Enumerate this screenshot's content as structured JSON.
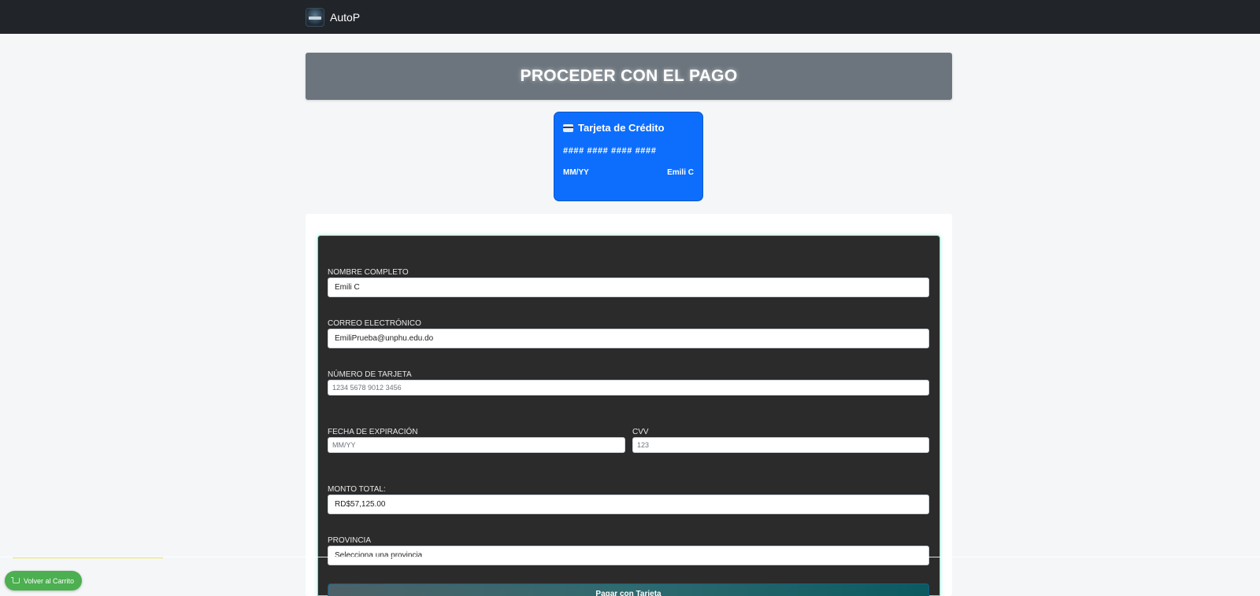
{
  "navbar": {
    "brand_name": "AutoP",
    "logo_icon": "autop-logo"
  },
  "page": {
    "title": "PROCEDER CON EL PAGO"
  },
  "card_preview": {
    "icon": "credit-card-icon",
    "title": "Tarjeta de Crédito",
    "number": "#### #### #### ####",
    "expiry": "MM/YY",
    "holder": "Emili C",
    "color": "#0d6efd"
  },
  "form": {
    "name": {
      "label": "NOMBRE COMPLETO",
      "value": "Emili C"
    },
    "email": {
      "label": "CORREO ELECTRÓNICO",
      "value": "EmiliPrueba@unphu.edu.do"
    },
    "card_number": {
      "label": "NÚMERO DE TARJETA",
      "placeholder": "1234 5678 9012 3456"
    },
    "expiry": {
      "label": "FECHA DE EXPIRACIÓN",
      "placeholder": "MM/YY"
    },
    "cvv": {
      "label": "CVV",
      "placeholder": "123"
    },
    "total": {
      "label": "MONTO TOTAL:",
      "value": "RD$57,125.00"
    },
    "province": {
      "label": "PROVINCIA",
      "selected": "Selecciona una provincia"
    },
    "pay_button": "Pagar con Tarjeta"
  },
  "floating": {
    "back_button": "Volver al Carrito",
    "back_icon": "cart-icon",
    "color": "#4caf50"
  }
}
